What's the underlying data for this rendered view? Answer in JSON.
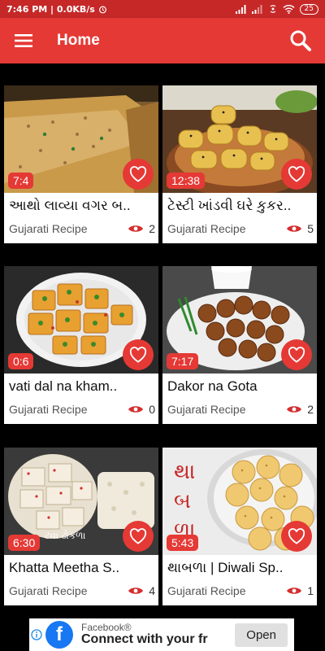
{
  "status": {
    "time_speed": "7:46 PM | 0.0KB/s",
    "battery": "25"
  },
  "app_bar": {
    "title": "Home",
    "menu_icon": "hamburger-menu-icon",
    "search_icon": "search-icon"
  },
  "colors": {
    "accent": "#e53935",
    "status": "#c62828",
    "background": "#000000"
  },
  "cards": [
    {
      "title": "આથો લાવ્યા વગર બ..",
      "duration": "7:4",
      "author": "Gujarati Recipe",
      "views": "2"
    },
    {
      "title": "ટેસ્ટી ખાંડવી ઘરે કુકર..",
      "duration": "12:38",
      "author": "Gujarati Recipe",
      "views": "5"
    },
    {
      "title": "vati dal na kham..",
      "duration": "0:6",
      "author": "Gujarati Recipe",
      "views": "0"
    },
    {
      "title": "Dakor na Gota",
      "duration": "7:17",
      "author": "Gujarati Recipe",
      "views": "2"
    },
    {
      "title": "Khatta Meetha S..",
      "duration": "6:30",
      "author": "Gujarati Recipe",
      "views": "4"
    },
    {
      "title": "થાબળા | Diwali Sp..",
      "duration": "5:43",
      "author": "Gujarati Recipe",
      "views": "1"
    }
  ],
  "thumb_text": {
    "card5_overlay": "ટ્વા ઢોકળા",
    "card6_overlay_1": "થા",
    "card6_overlay_2": "બ",
    "card6_overlay_3": "ળા"
  },
  "ad": {
    "brand": "Facebook®",
    "tagline": "Connect with your fr",
    "button": "Open",
    "logo_letter": "f"
  }
}
